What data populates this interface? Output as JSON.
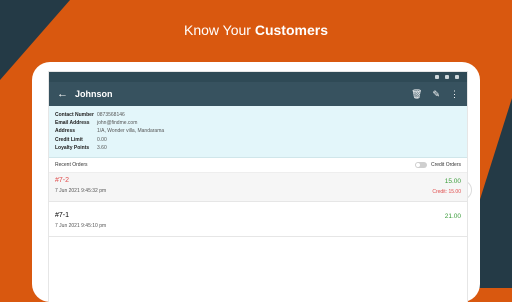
{
  "headline": {
    "normal": "Know Your ",
    "bold": "Customers"
  },
  "app": {
    "title": "Johnson",
    "back_icon": "arrow-left-icon",
    "action_icons": [
      "delete-icon",
      "edit-icon",
      "more-vert-icon"
    ]
  },
  "customer": {
    "fields": [
      {
        "label": "Contact Number",
        "value": "0873568146"
      },
      {
        "label": "Email Address",
        "value": "john@findme.com"
      },
      {
        "label": "Address",
        "value": "1/A, Wonder villa, Mandarama"
      },
      {
        "label": "Credit Limit",
        "value": "0.00"
      },
      {
        "label": "Loyalty Points",
        "value": "3.60"
      }
    ]
  },
  "orders_section": {
    "label": "Recent Orders",
    "toggle_label": "Credit Orders"
  },
  "orders": [
    {
      "id": "#7-2",
      "date": "7 Jun 2021 9:45:32 pm",
      "amount": "15.00",
      "credit": "Credit: 15.00"
    },
    {
      "id": "#7-1",
      "date": "7 Jun 2021 9:45:10 pm",
      "amount": "21.00",
      "credit": ""
    }
  ],
  "colors": {
    "orange": "#d9580f",
    "dark": "#243a46",
    "appbar": "#37525f",
    "info_bg": "#e3f6fa",
    "green": "#3a9c3a",
    "red": "#e04b4b"
  }
}
